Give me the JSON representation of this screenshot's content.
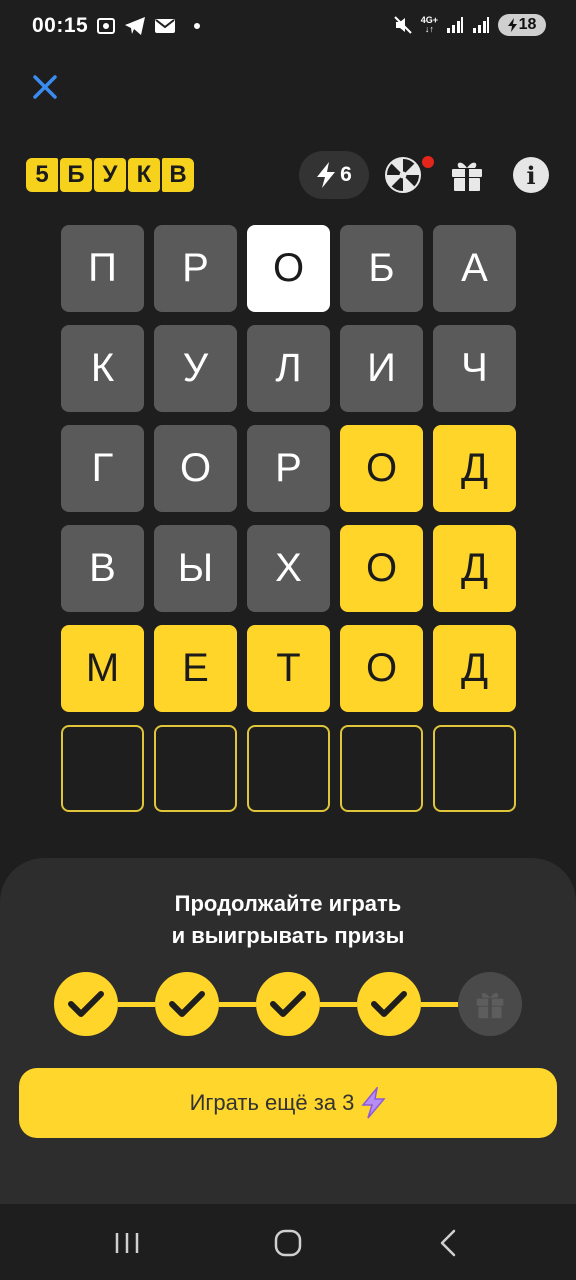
{
  "status_bar": {
    "time": "00:15",
    "network_top": "4G+",
    "battery": "18",
    "icons": [
      "screenshot-icon",
      "telegram-icon",
      "mail-icon",
      "dot-icon",
      "mute-icon",
      "signal-icon",
      "signal-icon",
      "battery-charging-icon"
    ]
  },
  "header": {
    "close_icon": "close-icon",
    "logo_letters": [
      "5",
      "Б",
      "У",
      "К",
      "В"
    ],
    "energy_count": "6",
    "icons": [
      "lightning-icon",
      "wheel-icon",
      "gift-icon",
      "info-icon"
    ],
    "info_glyph": "i"
  },
  "grid": {
    "rows": [
      {
        "letters": [
          "П",
          "Р",
          "О",
          "Б",
          "А"
        ],
        "states": [
          "absent",
          "absent",
          "current",
          "absent",
          "absent"
        ]
      },
      {
        "letters": [
          "К",
          "У",
          "Л",
          "И",
          "Ч"
        ],
        "states": [
          "absent",
          "absent",
          "absent",
          "absent",
          "absent"
        ]
      },
      {
        "letters": [
          "Г",
          "О",
          "Р",
          "О",
          "Д"
        ],
        "states": [
          "absent",
          "absent",
          "absent",
          "correct",
          "correct"
        ]
      },
      {
        "letters": [
          "В",
          "Ы",
          "Х",
          "О",
          "Д"
        ],
        "states": [
          "absent",
          "absent",
          "absent",
          "correct",
          "correct"
        ]
      },
      {
        "letters": [
          "М",
          "Е",
          "Т",
          "О",
          "Д"
        ],
        "states": [
          "correct",
          "correct",
          "correct",
          "correct",
          "correct"
        ]
      },
      {
        "letters": [
          "",
          "",
          "",
          "",
          ""
        ],
        "states": [
          "empty",
          "empty",
          "empty",
          "empty",
          "empty"
        ]
      }
    ]
  },
  "sheet": {
    "title_line1": "Продолжайте играть",
    "title_line2": "и выигрывать призы",
    "progress_completed": 4,
    "progress_total": 5,
    "play_button_label": "Играть ещё за 3",
    "colors": {
      "accent": "#ffd52a",
      "sheet_bg": "#2d2d2d",
      "absent_tile": "#5a5a5a"
    }
  },
  "navbar": {
    "icons": [
      "recent-apps-icon",
      "home-icon",
      "back-icon"
    ]
  }
}
